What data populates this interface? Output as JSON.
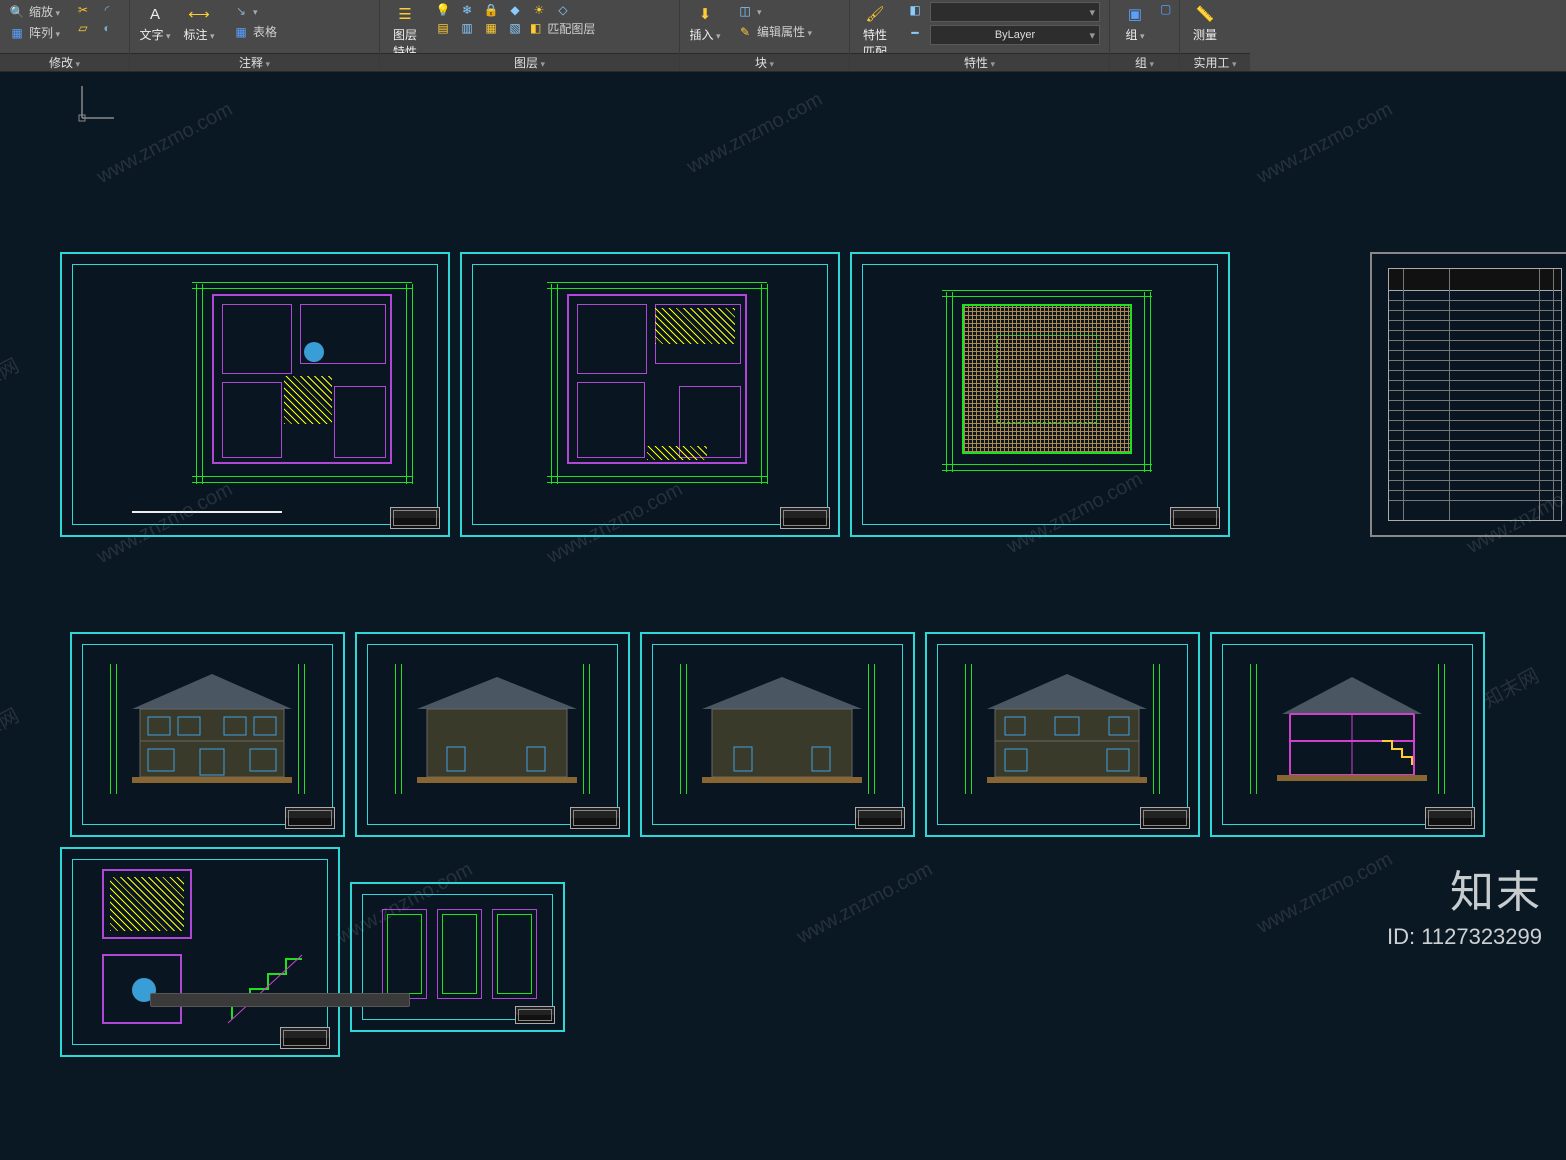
{
  "ribbon": {
    "panels": {
      "modify": {
        "label": "修改",
        "zoom": "缩放",
        "array": "阵列"
      },
      "annot": {
        "label": "注释",
        "text": "文字",
        "dim": "标注",
        "table": "表格"
      },
      "layers": {
        "label": "图层",
        "props": "图层\n特性",
        "match": "匹配图层"
      },
      "block": {
        "label": "块",
        "insert": "插入",
        "editattr": "编辑属性"
      },
      "props": {
        "label": "特性",
        "match": "特性\n匹配",
        "dropdown": "ByLayer"
      },
      "group": {
        "label": "组",
        "btn": "组"
      },
      "util": {
        "label": "实用工",
        "measure": "测量"
      }
    }
  },
  "canvas": {
    "ucs": "UCS"
  },
  "watermark": {
    "text": "www.znzmo.com",
    "site_cn": "知末网"
  },
  "brand": {
    "logo": "知末",
    "id_label": "ID: 1127323299"
  }
}
